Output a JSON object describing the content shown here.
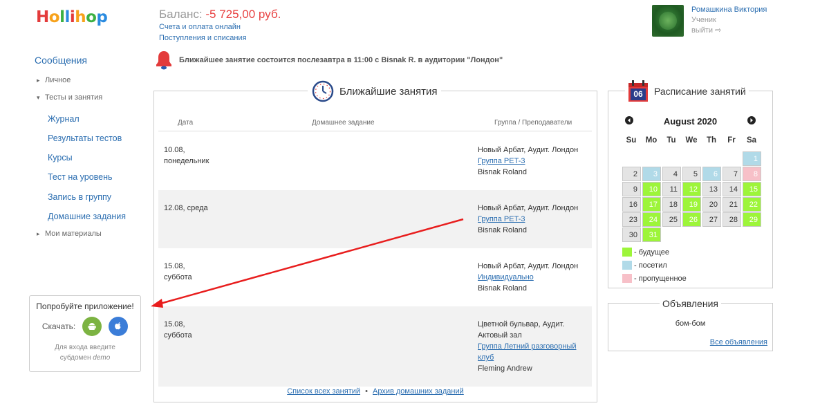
{
  "header": {
    "logo_letters": [
      "H",
      "o",
      "l",
      "l",
      "i",
      "h",
      "o",
      "p"
    ],
    "logo_colors": [
      "#e33b3b",
      "#f7a21b",
      "#3cb043",
      "#2a8be0",
      "#e33b3b",
      "#f7a21b",
      "#3cb043",
      "#2a8be0"
    ],
    "balance_label": "Баланс: ",
    "balance_value": "-5 725,00 руб.",
    "links": [
      "Счета и оплата онлайн",
      "Поступления и списания"
    ]
  },
  "user": {
    "name": "Ромашкина Виктория",
    "role": "Ученик",
    "logout": "выйти"
  },
  "sidebar": {
    "messages": "Сообщения",
    "sections": [
      {
        "label": "Личное",
        "expanded": false
      },
      {
        "label": "Тесты и занятия",
        "expanded": true
      },
      {
        "label": "Мои материалы",
        "expanded": false
      }
    ],
    "subitems": [
      "Журнал",
      "Результаты тестов",
      "Курсы",
      "Тест на уровень",
      "Запись в группу",
      "Домашние задания"
    ]
  },
  "app_promo": {
    "title": "Попробуйте приложение!",
    "download_label": "Скачать:",
    "note_line1": "Для входа введите",
    "note_line2_prefix": "субдомен ",
    "note_line2_em": "demo"
  },
  "notification": {
    "text": "Ближайшее занятие состоится послезавтра в 11:00 с Bisnak R. в аудитории \"Лондон\""
  },
  "lessons": {
    "title": "Ближайшие занятия",
    "columns": [
      "Дата",
      "Домашнее задание",
      "Группа / Преподаватели"
    ],
    "rows": [
      {
        "date1": "10.08,",
        "date2": "понедельник",
        "place": "Новый Арбат, Аудит. Лондон",
        "group": "Группа PET-3",
        "teacher": "Bisnak Roland"
      },
      {
        "date1": "12.08, среда",
        "date2": "",
        "place": "Новый Арбат, Аудит. Лондон",
        "group": "Группа PET-3",
        "teacher": "Bisnak Roland"
      },
      {
        "date1": "15.08,",
        "date2": "суббота",
        "place": "Новый Арбат, Аудит. Лондон",
        "group": "Индивидуально",
        "teacher": "Bisnak Roland"
      },
      {
        "date1": "15.08,",
        "date2": "суббота",
        "place1": "Цветной бульвар, Аудит.",
        "place2": "Актовый зал",
        "group1": "Группа Летний разговорный",
        "group2": "клуб",
        "teacher": "Fleming Andrew"
      }
    ],
    "footer_links": [
      "Список всех занятий",
      "Архив домашних заданий"
    ],
    "footer_sep": "•"
  },
  "schedule": {
    "title": "Расписание занятий",
    "icon_day": "06",
    "month": "August 2020",
    "weekdays": [
      "Su",
      "Mo",
      "Tu",
      "We",
      "Th",
      "Fr",
      "Sa"
    ],
    "days": [
      {
        "d": "1",
        "col": 6,
        "row": 0,
        "s": "v"
      },
      {
        "d": "2",
        "col": 0,
        "row": 1,
        "s": "n"
      },
      {
        "d": "3",
        "col": 1,
        "row": 1,
        "s": "v"
      },
      {
        "d": "4",
        "col": 2,
        "row": 1,
        "s": "n"
      },
      {
        "d": "5",
        "col": 3,
        "row": 1,
        "s": "n"
      },
      {
        "d": "6",
        "col": 4,
        "row": 1,
        "s": "v"
      },
      {
        "d": "7",
        "col": 5,
        "row": 1,
        "s": "n"
      },
      {
        "d": "8",
        "col": 6,
        "row": 1,
        "s": "m"
      },
      {
        "d": "9",
        "col": 0,
        "row": 2,
        "s": "n"
      },
      {
        "d": "10",
        "col": 1,
        "row": 2,
        "s": "f"
      },
      {
        "d": "11",
        "col": 2,
        "row": 2,
        "s": "n"
      },
      {
        "d": "12",
        "col": 3,
        "row": 2,
        "s": "f"
      },
      {
        "d": "13",
        "col": 4,
        "row": 2,
        "s": "n"
      },
      {
        "d": "14",
        "col": 5,
        "row": 2,
        "s": "n"
      },
      {
        "d": "15",
        "col": 6,
        "row": 2,
        "s": "f"
      },
      {
        "d": "16",
        "col": 0,
        "row": 3,
        "s": "n"
      },
      {
        "d": "17",
        "col": 1,
        "row": 3,
        "s": "f"
      },
      {
        "d": "18",
        "col": 2,
        "row": 3,
        "s": "n"
      },
      {
        "d": "19",
        "col": 3,
        "row": 3,
        "s": "f"
      },
      {
        "d": "20",
        "col": 4,
        "row": 3,
        "s": "n"
      },
      {
        "d": "21",
        "col": 5,
        "row": 3,
        "s": "n"
      },
      {
        "d": "22",
        "col": 6,
        "row": 3,
        "s": "f"
      },
      {
        "d": "23",
        "col": 0,
        "row": 4,
        "s": "n"
      },
      {
        "d": "24",
        "col": 1,
        "row": 4,
        "s": "f"
      },
      {
        "d": "25",
        "col": 2,
        "row": 4,
        "s": "n"
      },
      {
        "d": "26",
        "col": 3,
        "row": 4,
        "s": "f"
      },
      {
        "d": "27",
        "col": 4,
        "row": 4,
        "s": "n"
      },
      {
        "d": "28",
        "col": 5,
        "row": 4,
        "s": "n"
      },
      {
        "d": "29",
        "col": 6,
        "row": 4,
        "s": "f"
      },
      {
        "d": "30",
        "col": 0,
        "row": 5,
        "s": "n"
      },
      {
        "d": "31",
        "col": 1,
        "row": 5,
        "s": "f"
      }
    ],
    "legend": [
      {
        "label": "- будущее",
        "color": "#9df53a"
      },
      {
        "label": "- посетил",
        "color": "#b1dae8"
      },
      {
        "label": "- пропущенное",
        "color": "#f7c0c8"
      }
    ]
  },
  "announcements": {
    "title": "Объявления",
    "text": "бом-бом",
    "link": "Все объявления"
  },
  "colors": {
    "accent_link": "#2a6db0",
    "balance_negative": "#e84040",
    "arrow": "#e81d1d"
  }
}
